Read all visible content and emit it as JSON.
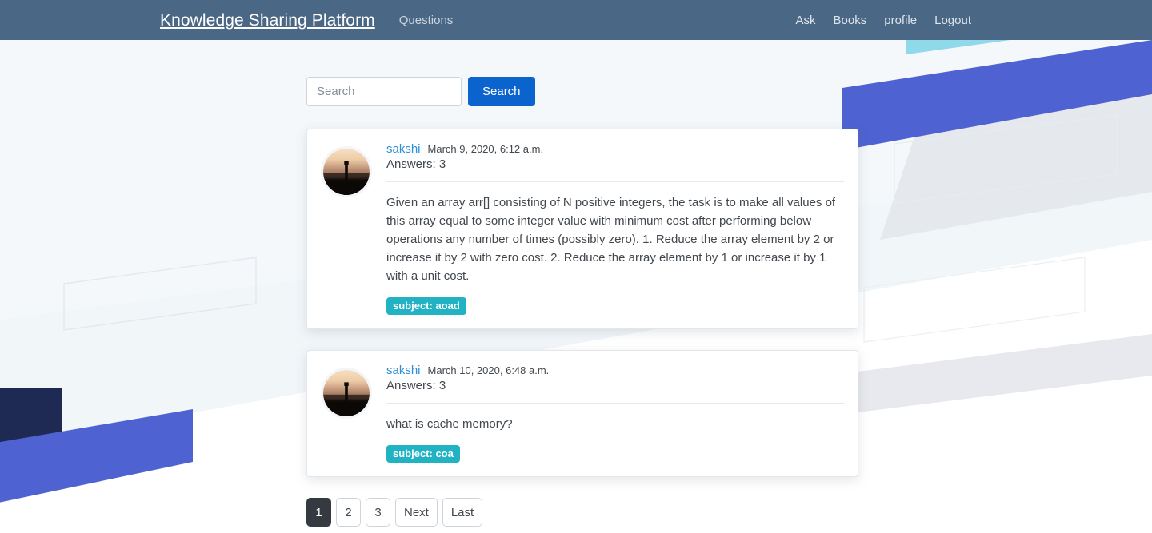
{
  "navbar": {
    "brand": "Knowledge Sharing Platform",
    "left_links": [
      {
        "label": "Questions",
        "name": "nav-link-questions"
      }
    ],
    "right_links": [
      {
        "label": "Ask",
        "name": "nav-link-ask"
      },
      {
        "label": "Books",
        "name": "nav-link-books"
      },
      {
        "label": "profile",
        "name": "nav-link-profile"
      },
      {
        "label": "Logout",
        "name": "nav-link-logout"
      }
    ],
    "background_color": "#4a6785"
  },
  "search": {
    "value": "",
    "placeholder": "Search",
    "button_label": "Search",
    "button_color": "#0b63ce"
  },
  "questions": [
    {
      "author": "sakshi",
      "timestamp": "March 9, 2020, 6:12 a.m.",
      "answers_label": "Answers: 3",
      "answers_count": 3,
      "body": "Given an array arr[] consisting of N positive integers, the task is to make all values of this array equal to some integer value with minimum cost after performing below operations any number of times (possibly zero). 1. Reduce the array element by 2 or increase it by 2 with zero cost. 2. Reduce the array element by 1 or increase it by 1 with a unit cost.",
      "badge": "subject: aoad",
      "badge_color": "#21b2c4",
      "avatar_alt": "sunset silhouette avatar"
    },
    {
      "author": "sakshi",
      "timestamp": "March 10, 2020, 6:48 a.m.",
      "answers_label": "Answers: 3",
      "answers_count": 3,
      "body": "what is cache memory?",
      "badge": "subject: coa",
      "badge_color": "#21b2c4",
      "avatar_alt": "sunset silhouette avatar"
    }
  ],
  "pagination": {
    "items": [
      {
        "label": "1",
        "active": true,
        "name": "page-1"
      },
      {
        "label": "2",
        "active": false,
        "name": "page-2"
      },
      {
        "label": "3",
        "active": false,
        "name": "page-3"
      },
      {
        "label": "Next",
        "active": false,
        "name": "page-next"
      },
      {
        "label": "Last",
        "active": false,
        "name": "page-last"
      }
    ],
    "active_page": 1,
    "active_color": "#343a40"
  },
  "background": {
    "colors": {
      "royal_blue": "#4f62d1",
      "navy": "#1f2a54",
      "cyan": "#8fd9ea",
      "pale_blue": "#eef4f8",
      "pale_grey": "#e4e7ec"
    }
  }
}
